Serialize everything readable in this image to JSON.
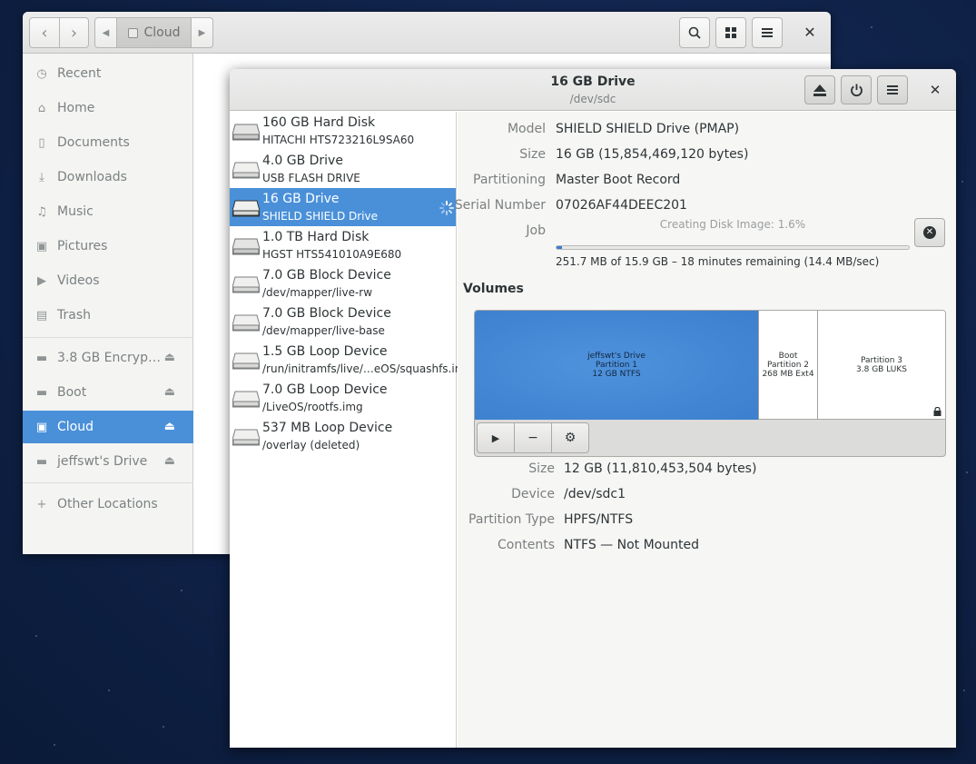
{
  "files": {
    "path_label": "Cloud",
    "sidebar": {
      "items": [
        {
          "label": "Recent",
          "icon": "clock-icon"
        },
        {
          "label": "Home",
          "icon": "home-icon"
        },
        {
          "label": "Documents",
          "icon": "document-icon"
        },
        {
          "label": "Downloads",
          "icon": "download-icon"
        },
        {
          "label": "Music",
          "icon": "music-icon"
        },
        {
          "label": "Pictures",
          "icon": "camera-icon"
        },
        {
          "label": "Videos",
          "icon": "video-icon"
        },
        {
          "label": "Trash",
          "icon": "trash-icon"
        }
      ],
      "devices": [
        {
          "label": "3.8 GB Encryp…",
          "icon": "drive-icon"
        },
        {
          "label": "Boot",
          "icon": "drive-icon"
        },
        {
          "label": "Cloud",
          "icon": "drive-icon",
          "active": true
        },
        {
          "label": "jeffswt's Drive",
          "icon": "drive-icon"
        }
      ],
      "other_locations": "Other Locations"
    }
  },
  "disks": {
    "title": "16 GB Drive",
    "subtitle": "/dev/sdc",
    "drives": [
      {
        "title": "160 GB Hard Disk",
        "subtitle": "HITACHI HTS723216L9SA60"
      },
      {
        "title": "4.0 GB Drive",
        "subtitle": "USB FLASH DRIVE"
      },
      {
        "title": "16 GB Drive",
        "subtitle": "SHIELD SHIELD Drive",
        "selected": true
      },
      {
        "title": "1.0 TB Hard Disk",
        "subtitle": "HGST HTS541010A9E680"
      },
      {
        "title": "7.0 GB Block Device",
        "subtitle": "/dev/mapper/live-rw"
      },
      {
        "title": "7.0 GB Block Device",
        "subtitle": "/dev/mapper/live-base"
      },
      {
        "title": "1.5 GB Loop Device",
        "subtitle": "/run/initramfs/live/…eOS/squashfs.img"
      },
      {
        "title": "7.0 GB Loop Device",
        "subtitle": "/LiveOS/rootfs.img"
      },
      {
        "title": "537 MB Loop Device",
        "subtitle": "/overlay (deleted)"
      }
    ],
    "drive_info": {
      "model_label": "Model",
      "model": "SHIELD SHIELD Drive (PMAP)",
      "size_label": "Size",
      "size": "16 GB (15,854,469,120 bytes)",
      "partitioning_label": "Partitioning",
      "partitioning": "Master Boot Record",
      "serial_label": "Serial Number",
      "serial": "07026AF44DEEC201",
      "job_label": "Job",
      "job_caption": "Creating Disk Image: 1.6%",
      "job_progress": 0.016,
      "job_status": "251.7 MB of 15.9 GB – 18 minutes remaining (14.4 MB/sec)"
    },
    "volumes_label": "Volumes",
    "partitions": [
      {
        "name": "jeffswt's Drive",
        "number": "Partition 1",
        "info": "12 GB NTFS"
      },
      {
        "name": "Boot",
        "number": "Partition 2",
        "info": "268 MB Ext4"
      },
      {
        "name": "Partition 3",
        "info": "3.8 GB LUKS"
      }
    ],
    "volume_info": {
      "size_label": "Size",
      "size": "12 GB (11,810,453,504 bytes)",
      "device_label": "Device",
      "device": "/dev/sdc1",
      "ptype_label": "Partition Type",
      "ptype": "HPFS/NTFS",
      "contents_label": "Contents",
      "contents": "NTFS — Not Mounted"
    }
  },
  "colors": {
    "accent": "#4a90d9",
    "partition_fill": "#3b7fce"
  }
}
